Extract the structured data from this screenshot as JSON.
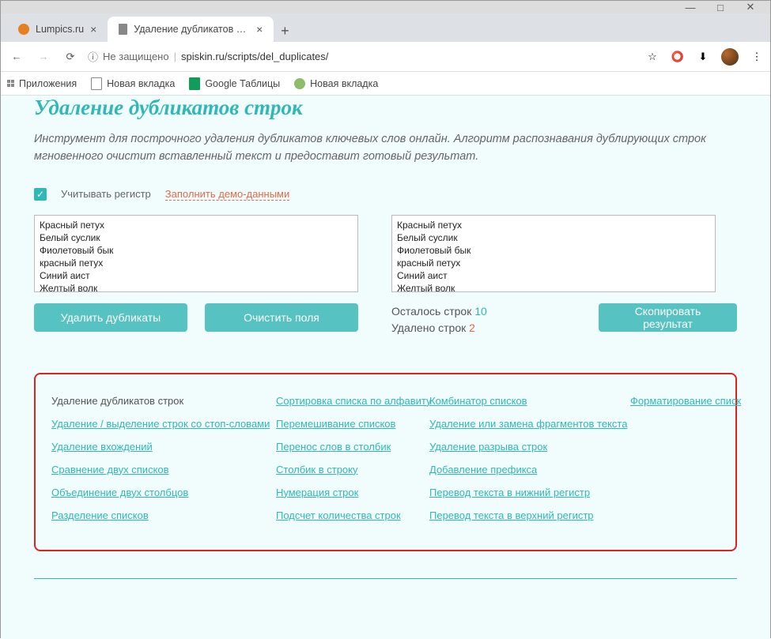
{
  "window": {
    "min": "—",
    "max": "□",
    "close": "✕"
  },
  "tabs": [
    {
      "title": "Lumpics.ru",
      "fav": "#e67e22",
      "active": false
    },
    {
      "title": "Удаление дубликатов строк - у...",
      "fav": "#888",
      "active": true
    }
  ],
  "nav": {
    "back": "←",
    "fwd": "→",
    "reload": "⟳",
    "info": "ⓘ",
    "secure": "Не защищено",
    "url": "spiskin.ru/scripts/del_duplicates/",
    "star": "☆"
  },
  "bookmarks": {
    "apps": "Приложения",
    "items": [
      "Новая вкладка",
      "Google Таблицы",
      "Новая вкладка"
    ]
  },
  "page": {
    "title": "Удаление дубликатов строк",
    "desc": "Инструмент для построчного удаления дубликатов ключевых слов онлайн. Алгоритм распознавания дублирующих строк мгновенного очистит вставленный текст и предоставит готовый результат.",
    "chk_label": "Учитывать регистр",
    "demo": "Заполнить демо-данными",
    "input": "Красный петух\nБелый суслик\nФиолетовый бык\nкрасный петух\nСиний аист\nЖелтый волк\nОранжевый медведь\nСиний аист",
    "output": "Красный петух\nБелый суслик\nФиолетовый бык\nкрасный петух\nСиний аист\nЖелтый волк\nОранжевый медведь\nЧерный страус",
    "btn_remove": "Удалить дубликаты",
    "btn_clear": "Очистить поля",
    "btn_copy": "Скопировать результат",
    "stats_left_label": "Осталось строк",
    "stats_left_val": "10",
    "stats_del_label": "Удалено строк",
    "stats_del_val": "2"
  },
  "links": {
    "col1": [
      "Удаление дубликатов строк",
      "Удаление / выделение строк со стоп-словами",
      "Удаление вхождений",
      "Сравнение двух списков",
      "Объединение двух столбцов",
      "Разделение списков"
    ],
    "col2": [
      "Сортировка списка по алфавиту",
      "Перемешивание списков",
      "Перенос слов в столбик",
      "Столбик в строку",
      "Нумерация строк",
      "Подсчет количества строк"
    ],
    "col3": [
      "Комбинатор списков",
      "Удаление или замена фрагментов текста",
      "Удаление разрыва строк",
      "Добавление префикса",
      "Перевод текста в нижний регистр",
      "Перевод текста в верхний регистр"
    ],
    "col4": [
      "Форматирование списк"
    ]
  }
}
